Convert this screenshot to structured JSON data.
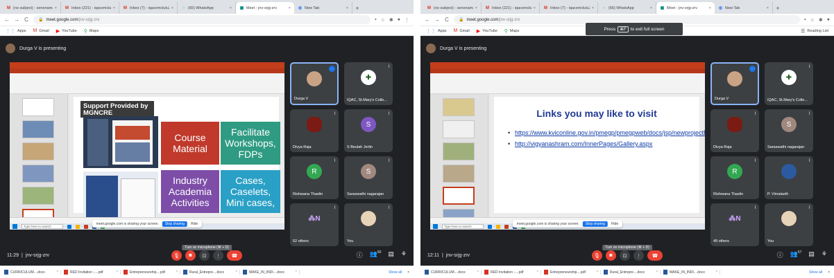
{
  "left": {
    "tabs": [
      {
        "label": "(no subject) - senenamary",
        "icon": "gmail-icon",
        "color": "#d93025",
        "glyph": "M"
      },
      {
        "label": "Inbox (221) - iqacemclutu",
        "icon": "gmail-icon",
        "color": "#d93025",
        "glyph": "M"
      },
      {
        "label": "Inbox (7) - iqacemclutu20",
        "icon": "gmail-icon",
        "color": "#d93025",
        "glyph": "M"
      },
      {
        "label": "(65) WhatsApp",
        "icon": "whatsapp-icon",
        "color": "#25d366",
        "glyph": "○"
      },
      {
        "label": "Meet - jnv-srjg-zrv",
        "icon": "meet-icon",
        "color": "#00897b",
        "glyph": "▣",
        "active": true
      },
      {
        "label": "New Tab",
        "icon": "chrome-icon",
        "color": "#4285f4",
        "glyph": "◍"
      }
    ],
    "url_host": "meet.google.com",
    "url_path": "/jnv-srjg-zrv",
    "presenter": "Durga V is presenting",
    "slide": {
      "support_title": "Support Provided by MGNCRE",
      "box1": "Course Material",
      "box2": "Facilitate Workshops, FDPs",
      "box3": "Industry Academia Activities",
      "box4": "Cases, Caselets, Mini cases,"
    },
    "share_text": "meet.google.com is sharing your screen.",
    "share_stop": "Stop sharing",
    "share_hide": "Hide",
    "win_search": "Type here to search",
    "tiles": [
      {
        "name": "Durga V",
        "type": "photo",
        "pinned": true
      },
      {
        "name": "IQAC, St.Mary's Colle...",
        "type": "logo"
      },
      {
        "name": "Divya Raja",
        "type": "rose"
      },
      {
        "name": "S Beulah Jerlin",
        "type": "letter",
        "letter": "S",
        "color": "#7e57c2"
      },
      {
        "name": "Rishwana Thaslin",
        "type": "letter",
        "letter": "R",
        "color": "#33a852"
      },
      {
        "name": "Saraswathi nagarajan",
        "type": "letter",
        "letter": "S",
        "color": "#a1887f"
      },
      {
        "name": "52 others",
        "type": "others"
      },
      {
        "name": "You",
        "type": "you"
      }
    ],
    "time": "11:29",
    "meeting_code": "jnv-srjg-zrv",
    "tooltip": "Turn on microphone (⌘ + D)",
    "people_count": "60"
  },
  "right": {
    "tabs": [
      {
        "label": "(no subject) - senenamary",
        "icon": "gmail-icon",
        "color": "#d93025",
        "glyph": "M"
      },
      {
        "label": "Inbox (221) - iqacemclutu",
        "icon": "gmail-icon",
        "color": "#d93025",
        "glyph": "M"
      },
      {
        "label": "Inbox (7) - iqacemclutu20",
        "icon": "gmail-icon",
        "color": "#d93025",
        "glyph": "M"
      },
      {
        "label": "(66) WhatsApp",
        "icon": "whatsapp-icon",
        "color": "#25d366",
        "glyph": "○"
      },
      {
        "label": "Meet - jnv-srjg-zrv",
        "icon": "meet-icon",
        "color": "#00897b",
        "glyph": "▣",
        "active": true
      },
      {
        "label": "New Tab",
        "icon": "chrome-icon",
        "color": "#4285f4",
        "glyph": "◍"
      }
    ],
    "url_host": "meet.google.com",
    "url_path": "/jnv-srjg-zrv",
    "presenter": "Durga V is presenting",
    "fullscreen_press": "Press",
    "fullscreen_key": "⌘F",
    "fullscreen_text": "to exit full screen",
    "slide": {
      "title": "Links you may like to visit",
      "links": [
        "https://www.kviconline.gov.in/pmegp/pmegpweb/docs/jsp/newprojectReports.jsp",
        "http://vigyanashram.com/InnerPages/Gallery.aspx"
      ]
    },
    "share_text": "meet.google.com is sharing your screen.",
    "share_stop": "Stop sharing",
    "share_hide": "Hide",
    "win_search": "Type here to search",
    "tiles": [
      {
        "name": "Durga V",
        "type": "photo",
        "pinned": true
      },
      {
        "name": "IQAC, St.Mary's Colle...",
        "type": "logo"
      },
      {
        "name": "Divya Raja",
        "type": "rose"
      },
      {
        "name": "Saraswathi nagarajan",
        "type": "letter",
        "letter": "S",
        "color": "#a1887f"
      },
      {
        "name": "Rishwana Thaslin",
        "type": "letter",
        "letter": "R",
        "color": "#33a852"
      },
      {
        "name": "P. Vimalaeth",
        "type": "photo2"
      },
      {
        "name": "49 others",
        "type": "others"
      },
      {
        "name": "You",
        "type": "you"
      }
    ],
    "time": "12:11",
    "meeting_code": "jnv-srjg-zrv",
    "tooltip": "Turn on microphone (⌘ + D)",
    "people_count": "57"
  },
  "bookmarks": {
    "apps": "Apps",
    "gmail": "Gmail",
    "youtube": "YouTube",
    "maps": "Maps",
    "reading_list": "Reading List"
  },
  "downloads": [
    {
      "name": "CURRICULUM....docx",
      "type": "doc"
    },
    {
      "name": "RED Invitation -....pdf",
      "type": "pdf"
    },
    {
      "name": "Entrepreneurship....pdf",
      "type": "pdf"
    },
    {
      "name": "Rural_Entrepre....docx",
      "type": "doc"
    },
    {
      "name": "MAKE_IN_INDI....docx",
      "type": "doc"
    }
  ],
  "show_all": "Show all",
  "colors": {
    "meet_bg": "#202124",
    "tile_bg": "#3c4043",
    "red": "#ea4335",
    "ppt": "#c43e1c"
  }
}
